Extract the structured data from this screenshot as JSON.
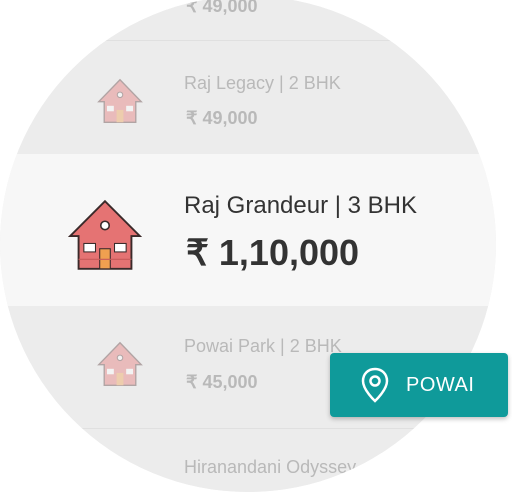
{
  "listings": [
    {
      "title": "",
      "price": "₹ 49,000",
      "state": "dim"
    },
    {
      "title": "Raj Legacy | 2 BHK",
      "price": "₹ 49,000",
      "state": "dim"
    },
    {
      "title": "Raj Grandeur | 3 BHK",
      "price": "₹ 1,10,000",
      "state": "active"
    },
    {
      "title": "Powai Park | 2 BHK",
      "price": "₹ 45,000",
      "state": "dim"
    },
    {
      "title": "Hiranandani Odyssey",
      "price": "",
      "state": "dim"
    }
  ],
  "location_button": {
    "label": "POWAI",
    "icon": "map-pin-icon"
  },
  "colors": {
    "accent": "#0f9a9a",
    "house": "#e57373"
  }
}
